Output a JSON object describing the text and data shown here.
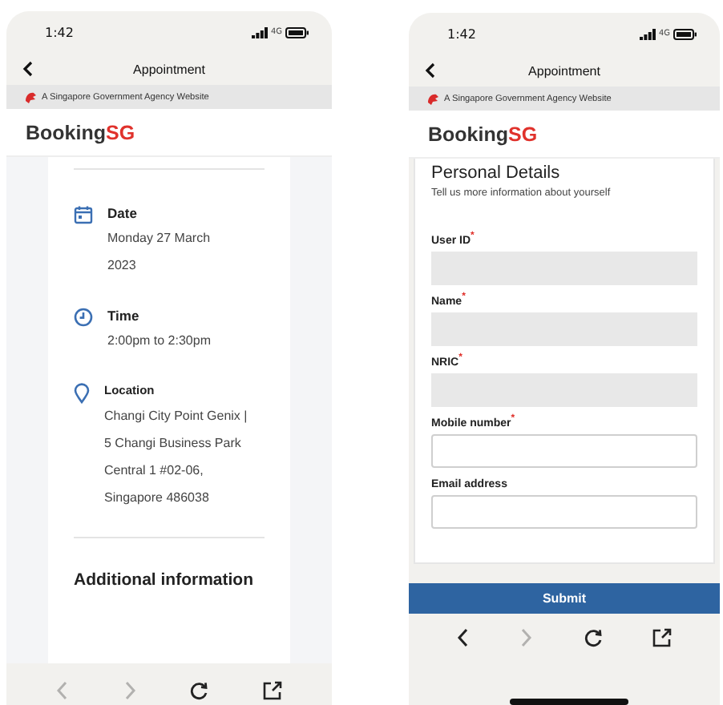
{
  "phones": [
    {
      "status": {
        "time": "1:42",
        "network": "4G"
      },
      "nav": {
        "title": "Appointment"
      },
      "banner": "A Singapore Government Agency Website",
      "logo": {
        "text": "Booking",
        "accent": "SG"
      },
      "content": {
        "kind": "details",
        "items": [
          {
            "kind": "date",
            "label": "Date",
            "value": "Monday 27 March 2023"
          },
          {
            "kind": "time",
            "label": "Time",
            "value": "2:00pm to 2:30pm"
          },
          {
            "kind": "location",
            "label": "Location",
            "value": "Changi City Point Genix | 5 Changi Business Park Central 1 #02-06, Singapore 486038"
          }
        ],
        "section_title": "Additional information"
      },
      "toolbar": [
        {
          "kind": "back",
          "disabled": true
        },
        {
          "kind": "forward",
          "disabled": true
        },
        {
          "kind": "reload",
          "disabled": false
        },
        {
          "kind": "share",
          "disabled": false
        }
      ],
      "home_indicator": false
    },
    {
      "status": {
        "time": "1:42",
        "network": "4G"
      },
      "nav": {
        "title": "Appointment"
      },
      "banner": "A Singapore Government Agency Website",
      "logo": {
        "text": "Booking",
        "accent": "SG"
      },
      "content": {
        "kind": "form",
        "title": "Personal Details",
        "subtitle": "Tell us more information about yourself",
        "fields": [
          {
            "label": "User ID",
            "required_mark": "*",
            "shaded": true
          },
          {
            "label": "Name",
            "required_mark": "*",
            "shaded": true
          },
          {
            "label": "NRIC",
            "required_mark": "*",
            "shaded": true
          },
          {
            "label": "Mobile number",
            "required_mark": "*",
            "shaded": false
          },
          {
            "label": "Email address",
            "shaded": false
          }
        ],
        "submit": "Submit"
      },
      "toolbar": [
        {
          "kind": "back",
          "disabled": false
        },
        {
          "kind": "forward",
          "disabled": true
        },
        {
          "kind": "reload",
          "disabled": false
        },
        {
          "kind": "share",
          "disabled": false
        }
      ],
      "home_indicator": true
    }
  ]
}
